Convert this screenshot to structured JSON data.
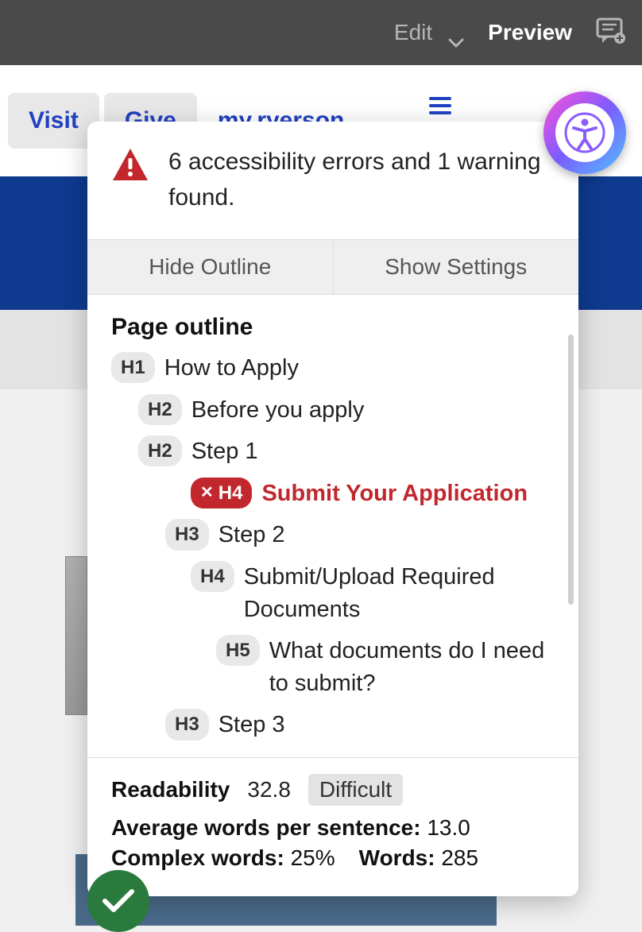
{
  "topbar": {
    "edit": "Edit",
    "preview": "Preview"
  },
  "nav": {
    "visit": "Visit",
    "give": "Give",
    "myryerson": "my.ryerson"
  },
  "panel": {
    "alert_text": "6 accessibility errors and 1 warning found.",
    "tab_hide": "Hide Outline",
    "tab_settings": "Show Settings",
    "outline_title": "Page outline",
    "headings": [
      {
        "level": "H1",
        "text": "How to Apply",
        "indent": 0,
        "error": false
      },
      {
        "level": "H2",
        "text": "Before you apply",
        "indent": 1,
        "error": false
      },
      {
        "level": "H2",
        "text": "Step 1",
        "indent": 1,
        "error": false
      },
      {
        "level": "H4",
        "text": "Submit Your Application",
        "indent": 3,
        "error": true
      },
      {
        "level": "H3",
        "text": "Step 2",
        "indent": 2,
        "error": false
      },
      {
        "level": "H4",
        "text": "Submit/Upload Required Documents",
        "indent": 3,
        "error": false
      },
      {
        "level": "H5",
        "text": "What documents do I need to submit?",
        "indent": 4,
        "error": false
      },
      {
        "level": "H3",
        "text": "Step 3",
        "indent": 2,
        "error": false
      }
    ],
    "readability": {
      "label": "Readability",
      "score": "32.8",
      "grade": "Difficult"
    },
    "stats": {
      "avg_label": "Average words per sentence:",
      "avg_val": "13.0",
      "complex_label": "Complex words:",
      "complex_val": "25%",
      "words_label": "Words:",
      "words_val": "285"
    }
  }
}
